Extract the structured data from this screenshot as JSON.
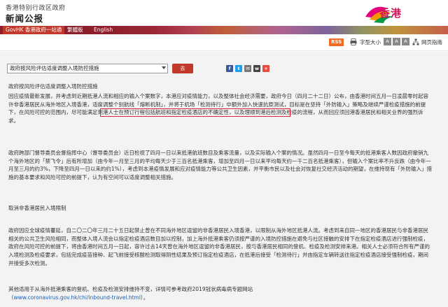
{
  "header": {
    "gov_name": "香港特别行政区政府",
    "site_title": "新闻公报",
    "logo_text": "香港",
    "brand_color": "#d4145a"
  },
  "nav": {
    "govhk": "GovHK 香港政府一站通",
    "traditional": "繁體版",
    "english": "English"
  },
  "utility": {
    "rss": "RSS",
    "font_size_label": "字型大小",
    "sizes": [
      "A",
      "A",
      "A"
    ],
    "sitemap": "网页指南"
  },
  "toolbar": {
    "select_value": "政府按风险评估适度调整入境防控措施",
    "go_label": "去",
    "share_icons": [
      "facebook-icon",
      "twitter-icon",
      "email-icon",
      "weibo-icon",
      "more-icon"
    ]
  },
  "article": {
    "title": "政府按风险评估适度调整入境防控措施",
    "para1": "因应疫情最新发展，并考虑到近期抵港人流和相应的输入个案数字，本港应对疫情能力，以及整体社会经济需要，政府今日（四月二十二日）公布，由香港时间五月一日凌晨零时起容许非香港居民从海外地区入境香港，适度调整个别航线「熔断机制」，并将于机场「检测待行」中额外加入快速抗原测试，目标是在坚持「外防输入」策略及继续严谨检疫措施的前提下，在风险可控的范围内，尽可能满足到港人士在预订行程包括航班和指定检疫酒店的不确定性，以及理顺到港后检测及检疫的流程，从而回应须回港香港居民和相关业界的强烈诉求。",
    "highlight": "由香港时间五月一日凌晨零时起容许非香港居民从海外地区入境香港",
    "para2": "政府跨部门督导委员会督指挥中心（督导委员会）近日检视了四月一日以来抵港航班数目及乘客流量，以及实际输入个案的情况。虽然四月一日至今每天的抵港乘客人数因政府撤销九个海外地区的「禁飞令」后有所增加（由今年一月至三月的平均每天少于三百名抵港乘客，增加至四月一日以来平均每天约一千二百名抵港乘客），但输入个案比率不升反跌（由今年一月至三月的约3%，下降至四月一日以来的约1%），考虑到本港疫情发展和应对疫情能力等公共卫生因素，并平衡市民以及社会对恢复社交经济活动的期望，在维持现有「外防输入」措施的基本要求和风险可控的前提下，认为有空间可以适度调整相关措施。",
    "section_heading": "取消非香港居民入境限制",
    "para3": "政府因应全球疫情蔓延，自二〇二〇年三月二十五日起禁止曾在不同海外地区逗留的非香港居民入境香港，以限制从海外地区抵港人流。考虑到来自同一地区的香港居民与非香港居民相关的公共卫生风险相同，而整体入境人流会以指定检疫酒店数目加以控制，加上海外抵港乘客仍须按严谨的入境防控措施在避免与社区接触的安排下在指定检疫酒店进行强制检疫，政府在风险可控的前提下，将由香港时间五月一日起，容许过去14天曾在海外地区逗留的非香港居民，按与香港居民相同的登机、检疫及检测安排来港。相关人士必须符合所有严谨的入境检测及检疫要求，包括完成疫苗接种、起飞前接受核酸检测取得阴性结果及预订指定检疫酒店，在抵港后接受「检测待行」并由指定车辆转送往指定检疫酒店接受强制检疫，期间并接受多次检测。",
    "para4_prefix": "其他适用于从海外抵港乘客的登机、检疫及检测安排维持不变，详情可参考政府2019冠状病毒病专题网站",
    "para4_link": "www.coronavirus.gov.hk/chi/inbound-travel.html",
    "para4_suffix": "）。"
  },
  "colors": {
    "nav_bg": "#8c1f2a",
    "go_button": "#c0392b",
    "highlight_border": "#d9263e",
    "link": "#1a5fb4"
  }
}
